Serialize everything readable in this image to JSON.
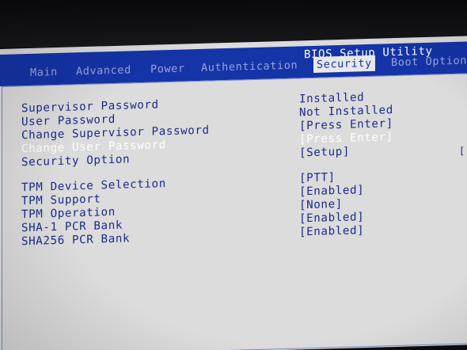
{
  "title": "BIOS Setup Utility",
  "tabs": [
    {
      "label": "Main",
      "active": false
    },
    {
      "label": "Advanced",
      "active": false
    },
    {
      "label": "Power",
      "active": false
    },
    {
      "label": "Authentication",
      "active": false
    },
    {
      "label": "Security",
      "active": true
    },
    {
      "label": "Boot Option",
      "active": false
    }
  ],
  "password_section": [
    {
      "label": "Supervisor Password",
      "value": "Installed"
    },
    {
      "label": "User Password",
      "value": "Not Installed"
    },
    {
      "label": "Change Supervisor Password",
      "value": "[Press Enter]"
    },
    {
      "label": "Change User Password",
      "value": "[Press Enter]",
      "selected": true
    },
    {
      "label": "Security Option",
      "value": "[Setup]"
    }
  ],
  "tpm_section": [
    {
      "label": "TPM Device Selection",
      "value": "[PTT]"
    },
    {
      "label": "TPM Support",
      "value": "[Enabled]"
    },
    {
      "label": "TPM Operation",
      "value": "[None]"
    },
    {
      "label": "SHA-1 PCR Bank",
      "value": "[Enabled]"
    },
    {
      "label": "SHA256 PCR Bank",
      "value": "[Enabled]"
    }
  ],
  "side_marker": "[",
  "colors": {
    "title_bar": "#1434a8",
    "screen_bg": "#dcdcdc",
    "text": "#1c2a8a",
    "selected_text": "#ffffff"
  }
}
